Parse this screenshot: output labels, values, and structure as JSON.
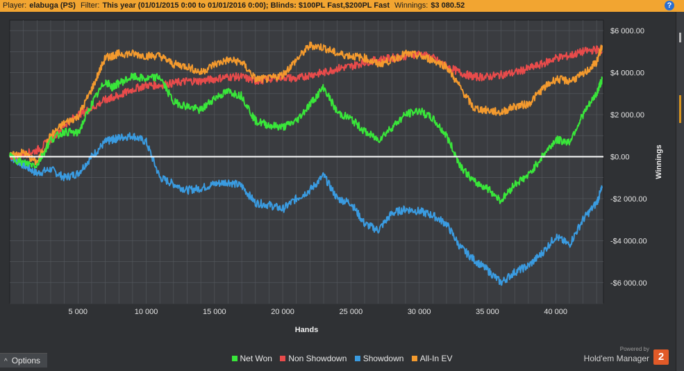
{
  "header": {
    "player_label": "Player:",
    "player_value": "elabuga (PS)",
    "filter_label": "Filter:",
    "filter_value": "This year (01/01/2015 0:00 to 01/01/2016 0:00); Blinds: $100PL Fast,$200PL Fast",
    "winnings_label": "Winnings:",
    "winnings_value": "$3 080.52",
    "help_icon": "?"
  },
  "options_button": {
    "label": "Options",
    "icon": "chevron-up-icon"
  },
  "brand": {
    "powered_by": "Powered by",
    "product": "Hold'em Manager",
    "logo_text": "2"
  },
  "colors": {
    "net_won": "#39e63a",
    "non_showdown": "#e84b4b",
    "showdown": "#3a9be0",
    "all_in_ev": "#f39a2e",
    "zero_line": "#ffffff",
    "plot_bg": "#3a3c40",
    "grid": "#565a5f"
  },
  "chart_data": {
    "type": "line",
    "xlabel": "Hands",
    "ylabel": "Winnings",
    "xlim": [
      0,
      43500
    ],
    "ylim": [
      -7000,
      6500
    ],
    "xticks": [
      5000,
      10000,
      15000,
      20000,
      25000,
      30000,
      35000,
      40000
    ],
    "xtick_labels": [
      "5 000",
      "10 000",
      "15 000",
      "20 000",
      "25 000",
      "30 000",
      "35 000",
      "40 000"
    ],
    "yticks": [
      6000,
      4000,
      2000,
      0,
      -2000,
      -4000,
      -6000
    ],
    "ytick_labels": [
      "$6 000.00",
      "$4 000.00",
      "$2 000.00",
      "$0.00",
      "-$2 000.00",
      "-$4 000.00",
      "-$6 000.00"
    ],
    "grid": true,
    "legend_position": "bottom-center",
    "x": [
      0,
      1000,
      2000,
      3000,
      4000,
      5000,
      6000,
      7000,
      7500,
      8000,
      9000,
      10000,
      11000,
      12000,
      13000,
      14000,
      15000,
      16000,
      17000,
      18000,
      19000,
      20000,
      21000,
      22000,
      23000,
      24000,
      25000,
      26000,
      27000,
      28000,
      29000,
      30000,
      31000,
      32000,
      33000,
      34000,
      35000,
      36000,
      37000,
      38000,
      39000,
      40000,
      41000,
      42000,
      43000,
      43400
    ],
    "series": [
      {
        "name": "Net Won",
        "color": "#39e63a",
        "values": [
          0,
          -300,
          -400,
          800,
          1200,
          1100,
          2500,
          3600,
          3300,
          3500,
          3800,
          3700,
          3800,
          2600,
          2400,
          2200,
          2800,
          3100,
          2900,
          1700,
          1500,
          1400,
          1700,
          2500,
          3300,
          2100,
          1800,
          1200,
          800,
          1400,
          2000,
          2200,
          1800,
          1000,
          -400,
          -1200,
          -1500,
          -2100,
          -1300,
          -900,
          0,
          800,
          700,
          2000,
          3000,
          3700
        ]
      },
      {
        "name": "Non Showdown",
        "color": "#e84b4b",
        "values": [
          0,
          100,
          300,
          800,
          1500,
          2000,
          2300,
          2700,
          2800,
          2900,
          3200,
          3400,
          3400,
          3500,
          3600,
          3600,
          3700,
          3800,
          3800,
          3600,
          3700,
          3800,
          3700,
          3900,
          4000,
          4200,
          4300,
          4500,
          4600,
          4700,
          4800,
          4900,
          4700,
          4300,
          4000,
          3800,
          3800,
          3900,
          4000,
          4200,
          4400,
          4700,
          4800,
          5000,
          5100,
          5000
        ]
      },
      {
        "name": "Showdown",
        "color": "#3a9be0",
        "values": [
          0,
          -400,
          -800,
          -600,
          -1000,
          -800,
          0,
          700,
          800,
          900,
          1000,
          700,
          -1000,
          -1300,
          -1600,
          -1500,
          -1300,
          -1200,
          -1400,
          -2200,
          -2300,
          -2500,
          -2000,
          -1600,
          -900,
          -2000,
          -2200,
          -3200,
          -3500,
          -2700,
          -2500,
          -2600,
          -2800,
          -3200,
          -4300,
          -4900,
          -5400,
          -6000,
          -5500,
          -5200,
          -4600,
          -3800,
          -4200,
          -3000,
          -2200,
          -1500
        ]
      },
      {
        "name": "All-In EV",
        "color": "#f39a2e",
        "values": [
          0,
          200,
          -300,
          1000,
          1600,
          1900,
          3200,
          4700,
          4800,
          4900,
          4900,
          4800,
          4800,
          4400,
          4300,
          4000,
          4400,
          4600,
          4500,
          3700,
          3700,
          3900,
          4600,
          5300,
          5200,
          4900,
          4800,
          4700,
          4400,
          4600,
          4900,
          4800,
          4600,
          4300,
          3300,
          2300,
          2200,
          2100,
          2400,
          2500,
          3200,
          3700,
          3600,
          3900,
          4500,
          5300
        ]
      }
    ]
  }
}
